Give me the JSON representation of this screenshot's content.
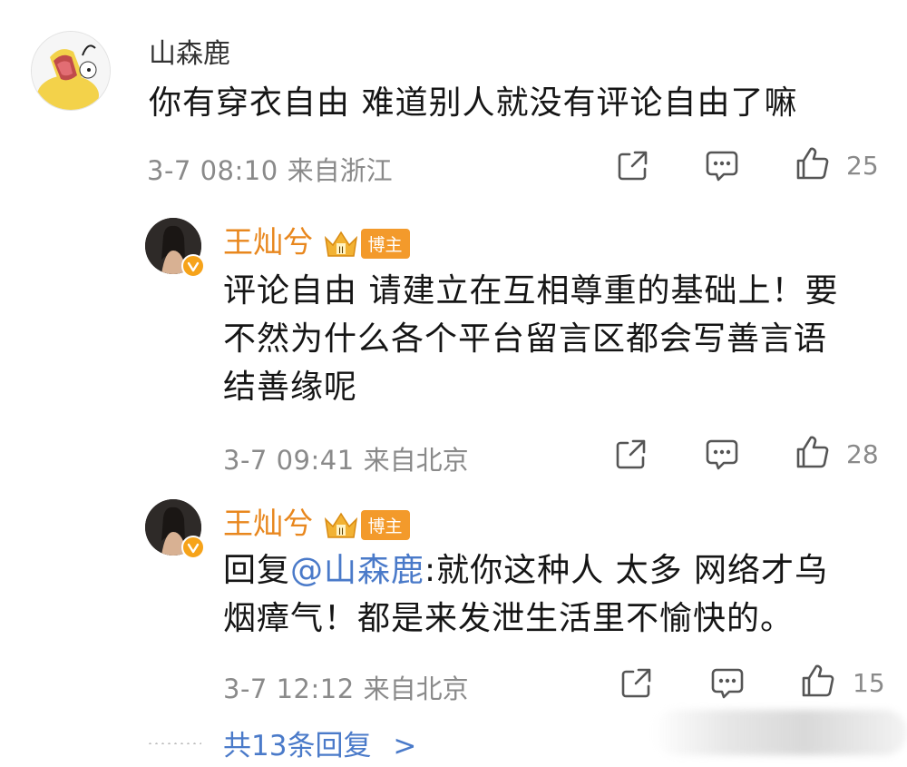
{
  "main_comment": {
    "username": "山森鹿",
    "text": "你有穿衣自由 难道别人就没有评论自由了嘛",
    "time": "3-7 08:10",
    "location": "来自浙江",
    "likes": "25"
  },
  "replies": [
    {
      "username": "王灿兮",
      "badge": "博主",
      "lines": [
        "评论自由 请建立在互相尊重的基础上！要",
        "不然为什么各个平台留言区都会写善言语",
        "结善缘呢"
      ],
      "time": "3-7 09:41",
      "location": "来自北京",
      "likes": "28"
    },
    {
      "username": "王灿兮",
      "badge": "博主",
      "reply_prefix": "回复",
      "mention": "@山森鹿",
      "line1_rest": ":就你这种人 太多 网络才乌",
      "line2": "烟瘴气！都是来发泄生活里不愉快的。",
      "time": "3-7 12:12",
      "location": "来自北京",
      "likes": "15"
    }
  ],
  "more_replies_label": "共13条回复",
  "more_replies_chevron": ">",
  "colors": {
    "username_orange": "#e8871e",
    "mention_blue": "#4a7ac9",
    "meta_gray": "#8a8a8a",
    "badge_orange": "#f39a2b"
  },
  "icons": [
    "share-icon",
    "comment-icon",
    "like-icon",
    "crown-icon",
    "verified-icon",
    "chevron-right-icon"
  ]
}
